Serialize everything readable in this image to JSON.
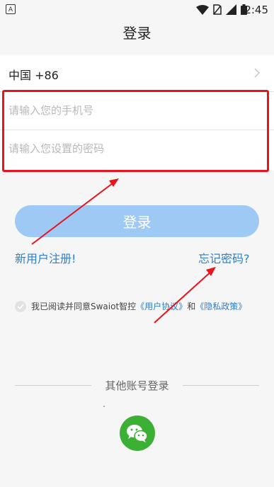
{
  "status_bar": {
    "app_badge": "A",
    "time": "2:45",
    "icons": [
      "wifi-icon",
      "sim-disabled-icon",
      "signal-icon",
      "battery-icon"
    ]
  },
  "header": {
    "title": "登录"
  },
  "form": {
    "country_label": "中国 +86",
    "phone_placeholder": "请输入您的手机号",
    "password_placeholder": "请输入您设置的密码"
  },
  "actions": {
    "login_label": "登录",
    "register_label": "新用户注册!",
    "forgot_label": "忘记密码?"
  },
  "agreement": {
    "prefix": "我已阅读并同意Swaiot智控",
    "user_agreement": "《用户协议》",
    "conjunction": "和",
    "privacy_policy": "《隐私政策》"
  },
  "other_login": {
    "label": "其他账号登录",
    "wechat_icon": "wechat-icon"
  },
  "colors": {
    "accent_blue": "#2b7fd1",
    "button_disabled": "#9ec9f5",
    "annotation_red": "#e8131c",
    "wechat_green": "#3cb035"
  }
}
